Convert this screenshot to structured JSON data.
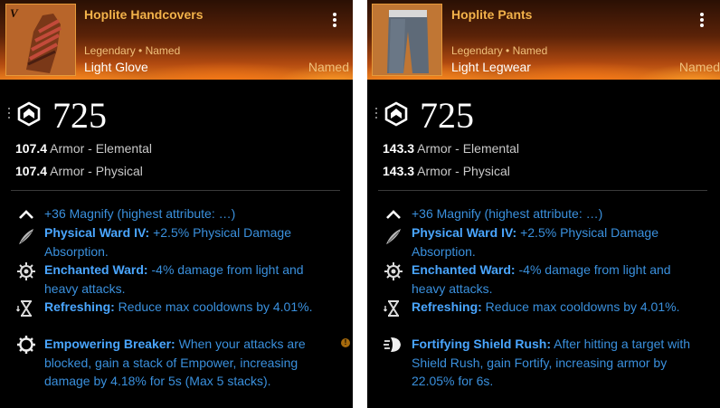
{
  "cards": [
    {
      "tier": "V",
      "name": "Hoplite Handcovers",
      "rarity_line": "Legendary • Named",
      "item_type": "Light Glove",
      "named_badge": "Named",
      "gear_score": "725",
      "stats": [
        {
          "value": "107.4",
          "label": "Armor - Elemental"
        },
        {
          "value": "107.4",
          "label": "Armor - Physical"
        }
      ],
      "perks": [
        {
          "icon": "chevron-up-icon",
          "name": "",
          "text": "+36 Magnify (highest attribute: …)"
        },
        {
          "icon": "feather-icon",
          "name": "Physical Ward IV:",
          "text": " +2.5% Physical Damage Absorption."
        },
        {
          "icon": "gear-burst-icon",
          "name": "Enchanted Ward:",
          "text": " -4% damage from light and heavy attacks."
        },
        {
          "icon": "hourglass-icon",
          "name": "Refreshing:",
          "text": " Reduce max cooldowns by 4.01%."
        },
        {
          "icon": "cog-icon",
          "name": "Empowering Breaker:",
          "text": " When your attacks are blocked, gain a stack of Empower, increasing damage by 4.18% for 5s (Max 5 stacks)."
        }
      ]
    },
    {
      "tier": "",
      "name": "Hoplite Pants",
      "rarity_line": "Legendary • Named",
      "item_type": "Light Legwear",
      "named_badge": "Named",
      "gear_score": "725",
      "stats": [
        {
          "value": "143.3",
          "label": "Armor - Elemental"
        },
        {
          "value": "143.3",
          "label": "Armor - Physical"
        }
      ],
      "perks": [
        {
          "icon": "chevron-up-icon",
          "name": "",
          "text": "+36 Magnify (highest attribute: …)"
        },
        {
          "icon": "feather-icon",
          "name": "Physical Ward IV:",
          "text": " +2.5% Physical Damage Absorption."
        },
        {
          "icon": "gear-burst-icon",
          "name": "Enchanted Ward:",
          "text": " -4% damage from light and heavy attacks."
        },
        {
          "icon": "hourglass-icon",
          "name": "Refreshing:",
          "text": " Reduce max cooldowns by 4.01%."
        },
        {
          "icon": "shield-rush-icon",
          "name": "Fortifying Shield Rush:",
          "text": " After hitting a target with Shield Rush, gain Fortify, increasing armor by 22.05% for 6s."
        }
      ]
    }
  ],
  "info_badge": "!",
  "colors": {
    "item_name": "#f2b24a",
    "perk_text": "#3a90dd",
    "perk_name": "#4aa6ff",
    "card_bg": "#000000"
  }
}
